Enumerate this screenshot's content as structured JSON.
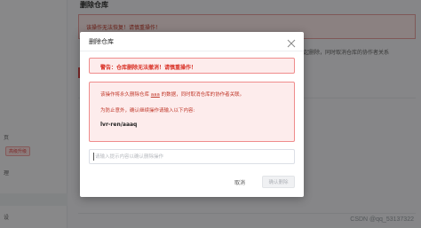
{
  "background": {
    "page_title": "删除仓库",
    "warning_banner": "该操作无法恢复！请慎重操作！",
    "right_text": "起删除，同时取消仓库的协作者关系",
    "sidebar": {
      "item1": "页",
      "badge": "高级升级",
      "item2": "理",
      "item3": "设"
    }
  },
  "dialog": {
    "title": "删除仓库",
    "alert": "警告：仓库删除无法撤消！请慎重操作！",
    "info_prefix": "该操作将永久删除仓库 ",
    "repo_name": "aaa",
    "info_suffix": " 的数据，同时取消仓库的协作者关联。",
    "confirm_prompt": "为防止意外，确认继续操作请输入以下内容:",
    "confirm_phrase": "lvr-ren/aaaq",
    "input": {
      "value": "",
      "placeholder": "请输入提示内容以确认删除操作"
    },
    "cancel_label": "取消",
    "confirm_label": "确认删除"
  },
  "watermark": "CSDN @qq_53137322",
  "colors": {
    "alert_red": "#d93025",
    "alert_bg": "#fdecec",
    "overlay": "rgba(0,0,0,0.45)"
  }
}
